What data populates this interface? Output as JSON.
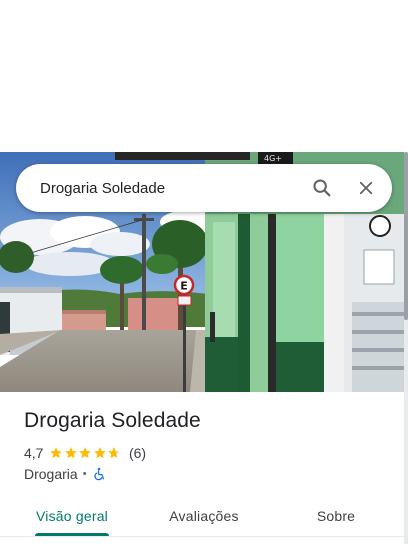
{
  "search": {
    "query": "Drogaria Soledade",
    "search_icon": "search-icon",
    "close_icon": "close-icon"
  },
  "photo": {
    "description_icon": "place-photo",
    "sign_letter": "E"
  },
  "place": {
    "name": "Drogaria Soledade",
    "rating": "4,7",
    "rating_value": 4.7,
    "stars_max": 5,
    "review_count": "(6)",
    "category": "Drogaria",
    "separator": "•",
    "accessibility_icon": "wheelchair-icon"
  },
  "tabs": [
    {
      "label": "Visão geral",
      "active": true
    },
    {
      "label": "Avaliações",
      "active": false
    },
    {
      "label": "Sobre",
      "active": false
    }
  ],
  "colors": {
    "accent": "#00796b",
    "star": "#fbbc04",
    "star_empty": "#dadce0",
    "accessibility": "#1a73e8"
  }
}
